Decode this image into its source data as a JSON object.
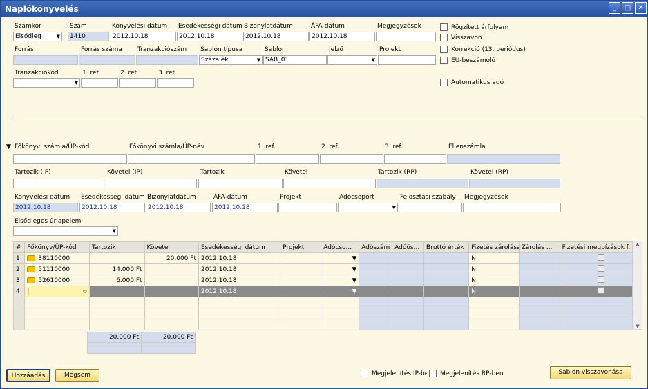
{
  "window": {
    "title": "Naplókönyvelés"
  },
  "header": {
    "labels": {
      "series": "Számkör",
      "number": "Szám",
      "posting_date": "Könyvelési dátum",
      "due_date": "Esedékességi dátum",
      "doc_date": "Bizonylatdátum",
      "vat_date": "ÁFA-dátum",
      "remarks": "Megjegyzések",
      "origin": "Forrás",
      "origin_no": "Forrás száma",
      "trans_no": "Tranzakciószám",
      "template_type": "Sablon típusa",
      "template": "Sablon",
      "indicator": "Jelző",
      "project": "Projekt",
      "trans_code": "Tranzakciókód",
      "ref1": "1. ref.",
      "ref2": "2. ref.",
      "ref3": "3. ref."
    },
    "values": {
      "series": "Elsődleg",
      "number": "1410",
      "posting_date": "2012.10.18",
      "due_date": "2012.10.18",
      "doc_date": "2012.10.18",
      "vat_date": "2012.10.18",
      "template_type": "Százalék",
      "template": "SAB_01"
    },
    "checks": {
      "fixed_rate": "Rögzített árfolyam",
      "reversal": "Visszavon",
      "correction": "Korrekció (13. periódus)",
      "eu_report": "EU-beszámoló",
      "auto_tax": "Automatikus adó"
    }
  },
  "line": {
    "labels": {
      "gl_code": "Főkönyvi számla/ÜP-kód",
      "gl_name": "Főkönyvi számla/ÜP-név",
      "ref1": "1. ref.",
      "ref2": "2. ref.",
      "ref3": "3. ref.",
      "contra": "Ellenszámla",
      "debit_fc": "Tartozik (IP)",
      "credit_fc": "Követel (IP)",
      "debit": "Tartozik",
      "credit": "Követel",
      "debit_sc": "Tartozik (RP)",
      "credit_sc": "Követel (RP)",
      "posting_date": "Könyvelési dátum",
      "due_date": "Esedékességi dátum",
      "doc_date": "Bizonylatdátum",
      "vat_date": "ÁFA-dátum",
      "project": "Projekt",
      "tax_group": "Adócsoport",
      "distr_rule": "Felosztási szabály",
      "remarks": "Megjegyzések",
      "primary_form": "Elsődleges űrlapelem"
    },
    "values": {
      "posting_date": "2012.10.18",
      "due_date": "2012.10.18",
      "doc_date": "2012.10.18",
      "vat_date": "2012.10.18"
    }
  },
  "table": {
    "headers": [
      "#",
      "Főkönyv/ÜP-kód",
      "Tartozik",
      "Követel",
      "Esedékességi dátum",
      "Projekt",
      "Adócso...",
      "Adószám",
      "Adóös...",
      "Bruttó érték",
      "Fizetés zárolása",
      "Zárolás ...",
      "Fizetési megbízások f..."
    ],
    "rows": [
      {
        "n": "1",
        "code": "38110000",
        "debit": "",
        "credit": "20.000 Ft",
        "due": "2012.10.18",
        "block": "N"
      },
      {
        "n": "2",
        "code": "51110000",
        "debit": "14.000 Ft",
        "credit": "",
        "due": "2012.10.18",
        "block": "N"
      },
      {
        "n": "3",
        "code": "52610000",
        "debit": "6.000 Ft",
        "credit": "",
        "due": "2012.10.18",
        "block": "N"
      },
      {
        "n": "4",
        "code": "",
        "debit": "",
        "credit": "",
        "due": "2012.10.18",
        "block": "N"
      }
    ],
    "total_debit": "20.000 Ft",
    "total_credit": "20.000 Ft"
  },
  "footer": {
    "add": "Hozzáadás",
    "cancel": "Mégsem",
    "show_fc": "Megjelenítés IP-be",
    "show_sc": "Megjelenítés RP-ben",
    "cancel_template": "Sablon visszavonása"
  }
}
